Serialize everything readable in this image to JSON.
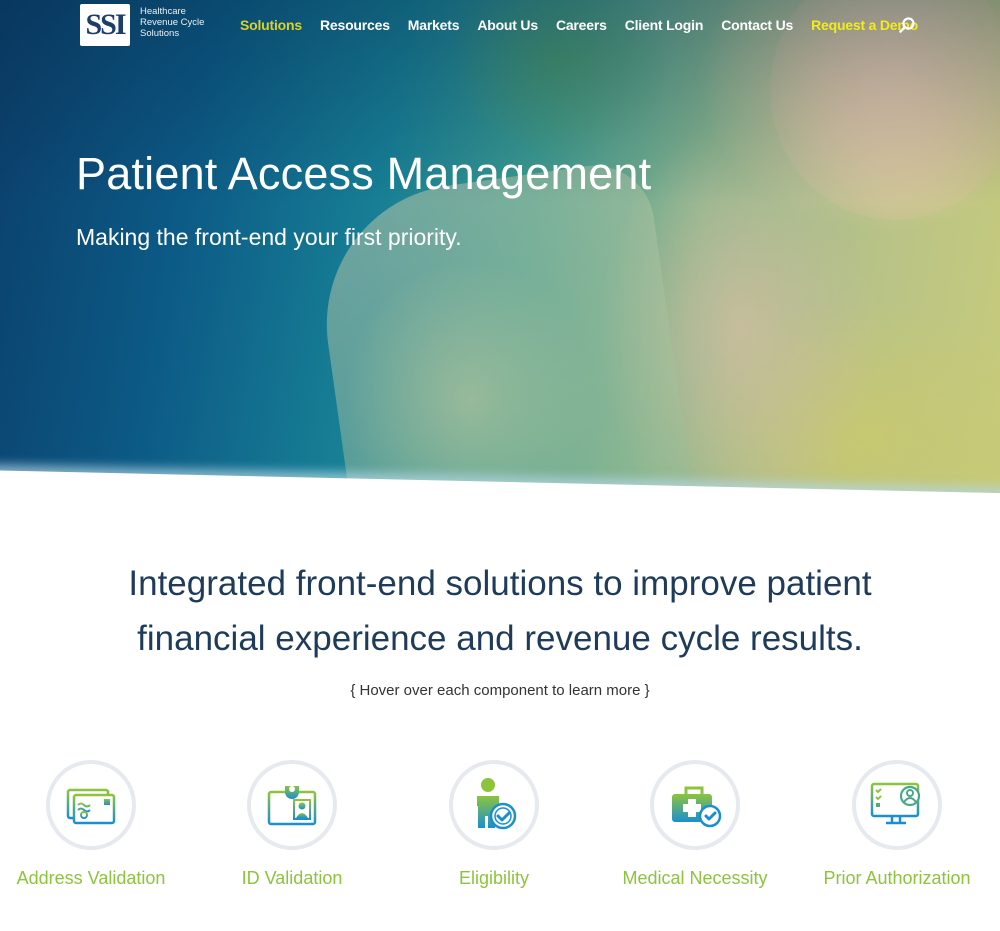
{
  "brand": {
    "logo_text": "SSI",
    "tagline_lines": [
      "Healthcare",
      "Revenue Cycle",
      "Solutions"
    ]
  },
  "nav": {
    "items": [
      {
        "label": "Solutions",
        "state": "active"
      },
      {
        "label": "Resources"
      },
      {
        "label": "Markets"
      },
      {
        "label": "About Us"
      },
      {
        "label": "Careers"
      },
      {
        "label": "Client Login"
      },
      {
        "label": "Contact Us"
      },
      {
        "label": "Request a Demo",
        "style": "highlight"
      }
    ],
    "search_icon": "search-icon"
  },
  "hero": {
    "title": "Patient Access Management",
    "subtitle": "Making the front-end your first priority."
  },
  "intro": {
    "heading_line1": "Integrated front-end solutions to improve patient",
    "heading_line2": "financial experience and revenue cycle results.",
    "hint": "{ Hover over each component to learn more }"
  },
  "components": [
    {
      "label": "Address Validation",
      "icon": "address-card-icon"
    },
    {
      "label": "ID Validation",
      "icon": "id-badge-icon"
    },
    {
      "label": "Eligibility",
      "icon": "person-check-icon"
    },
    {
      "label": "Medical Necessity",
      "icon": "medical-kit-check-icon"
    },
    {
      "label": "Prior Authorization",
      "icon": "monitor-checklist-icon"
    }
  ],
  "colors": {
    "accent_green": "#8cc43c",
    "nav_active": "#d7d22c",
    "demo_yellow": "#f2ec1e",
    "heading_navy": "#1f3b5a",
    "icon_gradient_top": "#8cc43c",
    "icon_gradient_bottom": "#1a8fd0"
  }
}
